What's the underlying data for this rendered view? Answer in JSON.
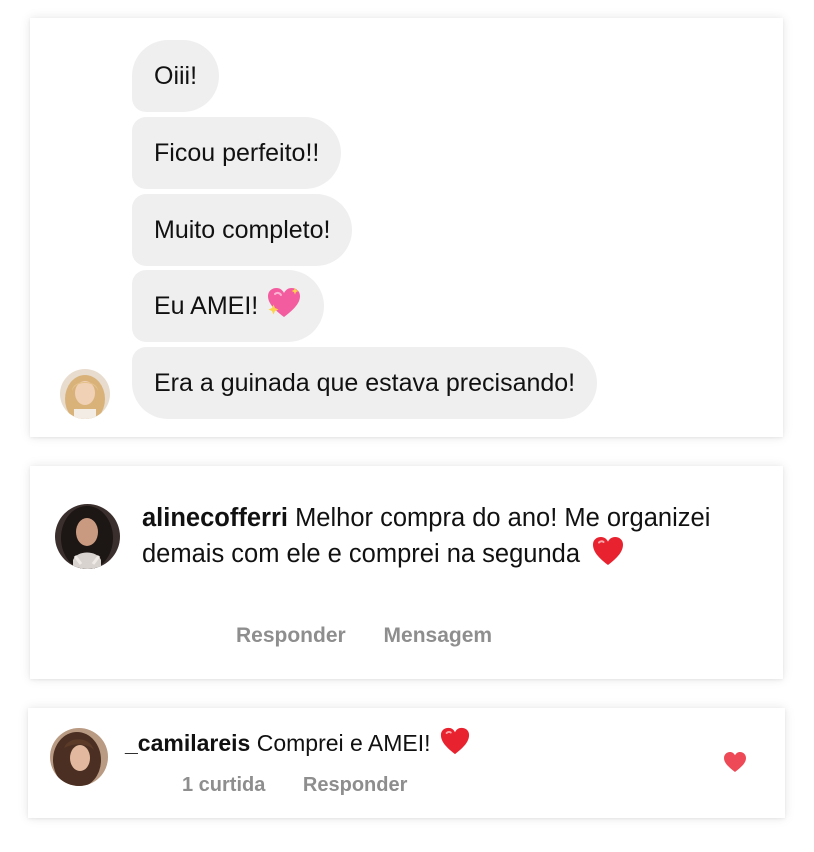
{
  "dm_messages": [
    {
      "text": "Oiii!"
    },
    {
      "text": "Ficou perfeito!!"
    },
    {
      "text": "Muito completo!"
    },
    {
      "text": "Eu AMEI!",
      "emoji": "sparkling-heart"
    },
    {
      "text": "Era a guinada que estava precisando!"
    }
  ],
  "comments": [
    {
      "username": "alinecofferri",
      "text": "Melhor compra do ano! Me organizei demais com ele e comprei na segunda",
      "emoji": "red-heart",
      "actions": [
        "Responder",
        "Mensagem"
      ]
    },
    {
      "username": "_camilareis",
      "text": "Comprei e AMEI!",
      "emoji": "red-heart",
      "likes": "1 curtida",
      "actions": [
        "Responder"
      ]
    }
  ],
  "colors": {
    "bubble_bg": "#efefef",
    "meta_text": "#8e8e8e",
    "like_heart": "#ed4956"
  }
}
